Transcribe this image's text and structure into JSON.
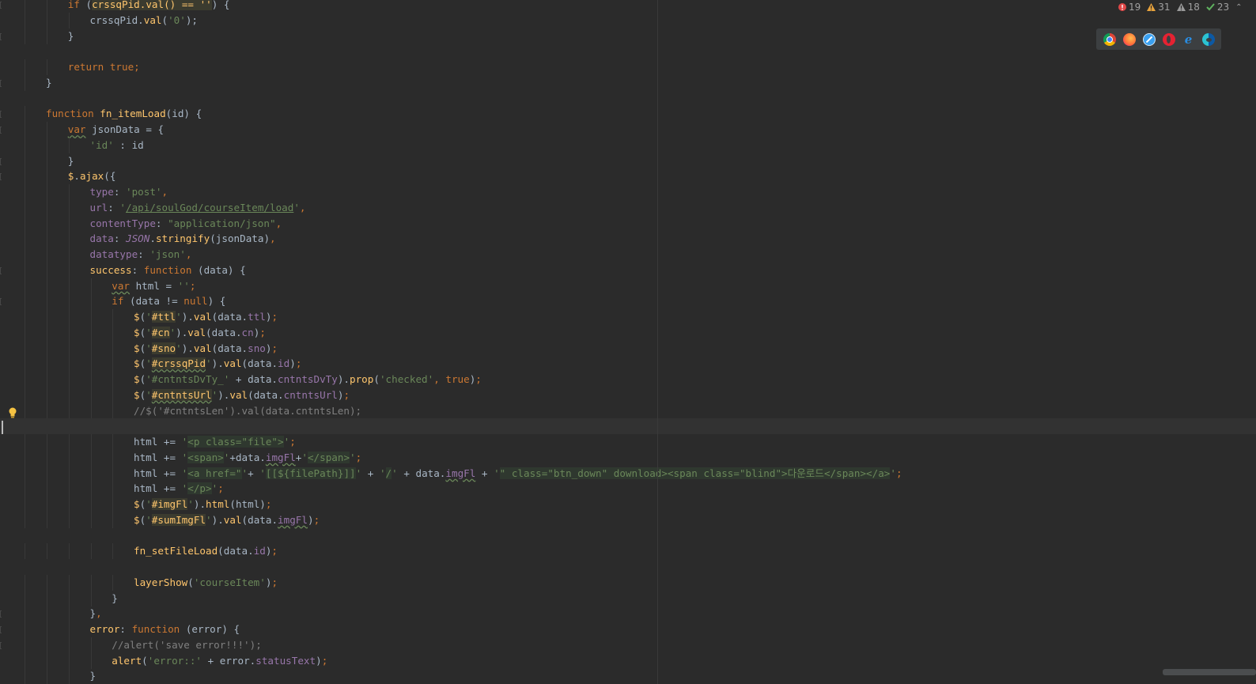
{
  "inspections": {
    "errors": "19",
    "warnings": "31",
    "weak_warnings": "18",
    "ok": "23"
  },
  "browsers": [
    "chrome-icon",
    "firefox-icon",
    "safari-icon",
    "opera-icon",
    "ie-icon",
    "edge-icon"
  ],
  "colors": {
    "background": "#2b2b2b",
    "keyword": "#cc7832",
    "string": "#6a8759",
    "function": "#ffc66d",
    "property": "#9876aa",
    "comment": "#808080",
    "text": "#a9b7c6",
    "error": "#e04747",
    "warning": "#e8a33d",
    "ok": "#5fb25f"
  },
  "code_lines": [
    {
      "indent": 3,
      "tokens": [
        [
          "kw",
          "if "
        ],
        [
          "t",
          "("
        ],
        [
          "sel",
          "crssqPid.val() == ''"
        ],
        [
          "t",
          ") {"
        ]
      ]
    },
    {
      "indent": 4,
      "tokens": [
        [
          "t",
          "crssqPid."
        ],
        [
          "fn",
          "val"
        ],
        [
          "t",
          "("
        ],
        [
          "str",
          "'0'"
        ],
        [
          "t",
          ");"
        ]
      ]
    },
    {
      "indent": 3,
      "tokens": [
        [
          "t",
          "}"
        ]
      ]
    },
    {
      "indent": 0,
      "tokens": []
    },
    {
      "indent": 3,
      "tokens": [
        [
          "kw",
          "return true"
        ],
        [
          "kw",
          ";"
        ]
      ]
    },
    {
      "indent": 2,
      "tokens": [
        [
          "t",
          "}"
        ]
      ]
    },
    {
      "indent": 0,
      "tokens": []
    },
    {
      "indent": 2,
      "tokens": [
        [
          "kw",
          "function "
        ],
        [
          "fn",
          "fn_itemLoad"
        ],
        [
          "t",
          "(id) {"
        ]
      ]
    },
    {
      "indent": 3,
      "tokens": [
        [
          "kwsq",
          "var"
        ],
        [
          "t",
          " jsonData = {"
        ]
      ]
    },
    {
      "indent": 4,
      "tokens": [
        [
          "str",
          "'id'"
        ],
        [
          "t",
          " : id"
        ]
      ]
    },
    {
      "indent": 3,
      "tokens": [
        [
          "t",
          "}"
        ]
      ]
    },
    {
      "indent": 3,
      "tokens": [
        [
          "fn",
          "$"
        ],
        [
          "t",
          "."
        ],
        [
          "fn",
          "ajax"
        ],
        [
          "t",
          "({"
        ]
      ]
    },
    {
      "indent": 4,
      "tokens": [
        [
          "prop",
          "type"
        ],
        [
          "t",
          ": "
        ],
        [
          "str",
          "'post'"
        ],
        [
          "kw",
          ","
        ]
      ]
    },
    {
      "indent": 4,
      "tokens": [
        [
          "prop",
          "url"
        ],
        [
          "t",
          ": "
        ],
        [
          "str",
          "'"
        ],
        [
          "link",
          "/api/soulGod/courseItem/load"
        ],
        [
          "str",
          "'"
        ],
        [
          "kw",
          ","
        ]
      ]
    },
    {
      "indent": 4,
      "tokens": [
        [
          "prop",
          "contentType"
        ],
        [
          "t",
          ": "
        ],
        [
          "str",
          "\"application/json\""
        ],
        [
          "kw",
          ","
        ]
      ]
    },
    {
      "indent": 4,
      "tokens": [
        [
          "prop",
          "data"
        ],
        [
          "t",
          ": "
        ],
        [
          "propi",
          "JSON"
        ],
        [
          "t",
          "."
        ],
        [
          "fn",
          "stringify"
        ],
        [
          "t",
          "(jsonData)"
        ],
        [
          "kw",
          ","
        ]
      ]
    },
    {
      "indent": 4,
      "tokens": [
        [
          "prop",
          "datatype"
        ],
        [
          "t",
          ": "
        ],
        [
          "str",
          "'json'"
        ],
        [
          "kw",
          ","
        ]
      ]
    },
    {
      "indent": 4,
      "tokens": [
        [
          "fn",
          "success"
        ],
        [
          "t",
          ": "
        ],
        [
          "kw",
          "function "
        ],
        [
          "t",
          "(data) {"
        ]
      ]
    },
    {
      "indent": 5,
      "tokens": [
        [
          "kwsq",
          "var"
        ],
        [
          "t",
          " html = "
        ],
        [
          "str",
          "''"
        ],
        [
          "kw",
          ";"
        ]
      ]
    },
    {
      "indent": 5,
      "tokens": [
        [
          "kw",
          "if "
        ],
        [
          "t",
          "(data != "
        ],
        [
          "kw",
          "null"
        ],
        [
          "t",
          ") {"
        ]
      ]
    },
    {
      "indent": 6,
      "tokens": [
        [
          "fn",
          "$"
        ],
        [
          "t",
          "("
        ],
        [
          "str",
          "'"
        ],
        [
          "sel",
          "#ttl"
        ],
        [
          "str",
          "'"
        ],
        [
          "t",
          ")."
        ],
        [
          "fn",
          "val"
        ],
        [
          "t",
          "(data."
        ],
        [
          "prop",
          "ttl"
        ],
        [
          "t",
          ")"
        ],
        [
          "kw",
          ";"
        ]
      ]
    },
    {
      "indent": 6,
      "tokens": [
        [
          "fn",
          "$"
        ],
        [
          "t",
          "("
        ],
        [
          "str",
          "'"
        ],
        [
          "sel",
          "#cn"
        ],
        [
          "str",
          "'"
        ],
        [
          "t",
          ")."
        ],
        [
          "fn",
          "val"
        ],
        [
          "t",
          "(data."
        ],
        [
          "prop",
          "cn"
        ],
        [
          "t",
          ")"
        ],
        [
          "kw",
          ";"
        ]
      ]
    },
    {
      "indent": 6,
      "tokens": [
        [
          "fn",
          "$"
        ],
        [
          "t",
          "("
        ],
        [
          "str",
          "'"
        ],
        [
          "sel",
          "#sno"
        ],
        [
          "str",
          "'"
        ],
        [
          "t",
          ")."
        ],
        [
          "fn",
          "val"
        ],
        [
          "t",
          "(data."
        ],
        [
          "prop",
          "sno"
        ],
        [
          "t",
          ")"
        ],
        [
          "kw",
          ";"
        ]
      ]
    },
    {
      "indent": 6,
      "tokens": [
        [
          "fn",
          "$"
        ],
        [
          "t",
          "("
        ],
        [
          "str",
          "'"
        ],
        [
          "selsq",
          "#crssqPid"
        ],
        [
          "str",
          "'"
        ],
        [
          "t",
          ")."
        ],
        [
          "fn",
          "val"
        ],
        [
          "t",
          "(data."
        ],
        [
          "prop",
          "id"
        ],
        [
          "t",
          ")"
        ],
        [
          "kw",
          ";"
        ]
      ]
    },
    {
      "indent": 6,
      "tokens": [
        [
          "fn",
          "$"
        ],
        [
          "t",
          "("
        ],
        [
          "str",
          "'#cntntsDvTy_'"
        ],
        [
          "t",
          " + data."
        ],
        [
          "prop",
          "cntntsDvTy"
        ],
        [
          "t",
          ")."
        ],
        [
          "fn",
          "prop"
        ],
        [
          "t",
          "("
        ],
        [
          "str",
          "'checked'"
        ],
        [
          "kw",
          ", true"
        ],
        [
          "t",
          ")"
        ],
        [
          "kw",
          ";"
        ]
      ]
    },
    {
      "indent": 6,
      "tokens": [
        [
          "fn",
          "$"
        ],
        [
          "t",
          "("
        ],
        [
          "str",
          "'"
        ],
        [
          "selsq",
          "#cntntsUrl"
        ],
        [
          "str",
          "'"
        ],
        [
          "t",
          ")."
        ],
        [
          "fn",
          "val"
        ],
        [
          "t",
          "(data."
        ],
        [
          "prop",
          "cntntsUrl"
        ],
        [
          "t",
          ")"
        ],
        [
          "kw",
          ";"
        ]
      ]
    },
    {
      "indent": 6,
      "tokens": [
        [
          "com",
          "//$('#cntntsLen').val(data.cntntsLen);"
        ]
      ]
    },
    {
      "indent": 0,
      "tokens": [],
      "current": true
    },
    {
      "indent": 6,
      "tokens": [
        [
          "t",
          "html += "
        ],
        [
          "str",
          "'"
        ],
        [
          "html",
          "<p class=\"file\">"
        ],
        [
          "str",
          "'"
        ],
        [
          "kw",
          ";"
        ]
      ]
    },
    {
      "indent": 6,
      "tokens": [
        [
          "t",
          "html += "
        ],
        [
          "str",
          "'"
        ],
        [
          "html",
          "<span>"
        ],
        [
          "str",
          "'"
        ],
        [
          "t",
          "+data."
        ],
        [
          "propsq",
          "imgFl"
        ],
        [
          "t",
          "+"
        ],
        [
          "str",
          "'"
        ],
        [
          "html",
          "</span>"
        ],
        [
          "str",
          "'"
        ],
        [
          "kw",
          ";"
        ]
      ]
    },
    {
      "indent": 6,
      "tokens": [
        [
          "t",
          "html += "
        ],
        [
          "str",
          "'"
        ],
        [
          "html",
          "<a href=\""
        ],
        [
          "str",
          "'"
        ],
        [
          "t",
          "+ "
        ],
        [
          "str",
          "'"
        ],
        [
          "html",
          "[[${filePath}]]"
        ],
        [
          "str",
          "'"
        ],
        [
          "t",
          " + "
        ],
        [
          "str",
          "'"
        ],
        [
          "html",
          "/"
        ],
        [
          "str",
          "'"
        ],
        [
          "t",
          " + data."
        ],
        [
          "propsq",
          "imgFl"
        ],
        [
          "t",
          " + "
        ],
        [
          "str",
          "'"
        ],
        [
          "html",
          "\" class=\"btn_down\" download><span class=\"blind\">다운로드</span></a>"
        ],
        [
          "str",
          "'"
        ],
        [
          "kw",
          ";"
        ]
      ]
    },
    {
      "indent": 6,
      "tokens": [
        [
          "t",
          "html += "
        ],
        [
          "str",
          "'"
        ],
        [
          "html",
          "</p>"
        ],
        [
          "str",
          "'"
        ],
        [
          "kw",
          ";"
        ]
      ]
    },
    {
      "indent": 6,
      "tokens": [
        [
          "fn",
          "$"
        ],
        [
          "t",
          "("
        ],
        [
          "str",
          "'"
        ],
        [
          "sel",
          "#imgFl"
        ],
        [
          "str",
          "'"
        ],
        [
          "t",
          ")."
        ],
        [
          "fn",
          "html"
        ],
        [
          "t",
          "(html)"
        ],
        [
          "kw",
          ";"
        ]
      ]
    },
    {
      "indent": 6,
      "tokens": [
        [
          "fn",
          "$"
        ],
        [
          "t",
          "("
        ],
        [
          "str",
          "'"
        ],
        [
          "sel",
          "#sumImgFl"
        ],
        [
          "str",
          "'"
        ],
        [
          "t",
          ")."
        ],
        [
          "fn",
          "val"
        ],
        [
          "t",
          "(data."
        ],
        [
          "propsq",
          "imgFl"
        ],
        [
          "t",
          ")"
        ],
        [
          "kw",
          ";"
        ]
      ]
    },
    {
      "indent": 0,
      "tokens": []
    },
    {
      "indent": 6,
      "tokens": [
        [
          "fn",
          "fn_setFileLoad"
        ],
        [
          "t",
          "(data."
        ],
        [
          "prop",
          "id"
        ],
        [
          "t",
          ")"
        ],
        [
          "kw",
          ";"
        ]
      ]
    },
    {
      "indent": 0,
      "tokens": []
    },
    {
      "indent": 6,
      "tokens": [
        [
          "fn",
          "layerShow"
        ],
        [
          "t",
          "("
        ],
        [
          "str",
          "'courseItem'"
        ],
        [
          "t",
          ")"
        ],
        [
          "kw",
          ";"
        ]
      ]
    },
    {
      "indent": 5,
      "tokens": [
        [
          "t",
          "}"
        ]
      ]
    },
    {
      "indent": 4,
      "tokens": [
        [
          "t",
          "}"
        ],
        [
          "kw",
          ","
        ]
      ]
    },
    {
      "indent": 4,
      "tokens": [
        [
          "fn",
          "error"
        ],
        [
          "t",
          ": "
        ],
        [
          "kw",
          "function "
        ],
        [
          "t",
          "(error) {"
        ]
      ]
    },
    {
      "indent": 5,
      "tokens": [
        [
          "com",
          "//alert('save error!!!');"
        ]
      ]
    },
    {
      "indent": 5,
      "tokens": [
        [
          "fn",
          "alert"
        ],
        [
          "t",
          "("
        ],
        [
          "str",
          "'error::'"
        ],
        [
          "t",
          " + error."
        ],
        [
          "prop",
          "statusText"
        ],
        [
          "t",
          ")"
        ],
        [
          "kw",
          ";"
        ]
      ]
    },
    {
      "indent": 4,
      "tokens": [
        [
          "t",
          "}"
        ]
      ]
    }
  ]
}
